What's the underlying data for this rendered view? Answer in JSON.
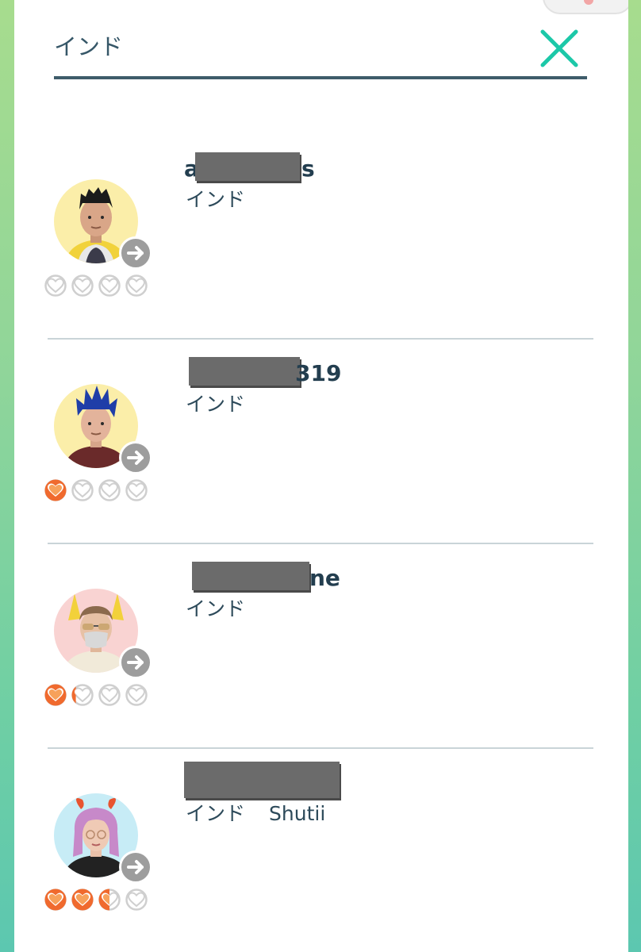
{
  "search": {
    "value": "インド",
    "placeholder": ""
  },
  "clear_icon": "close-icon",
  "colors": {
    "accent": "#1cc8a8",
    "heart_full": "#f06a2e",
    "heart_empty": "#cfcfcf",
    "name_text": "#233e4f"
  },
  "friends": [
    {
      "name_start": "a",
      "name_end": "s",
      "country": "インド",
      "sub": "",
      "friendship_level": 0,
      "avatar_bg": "#fbeea9"
    },
    {
      "name_start": "",
      "name_end": "319",
      "country": "インド",
      "sub": "",
      "friendship_level": 1,
      "avatar_bg": "#fbeea9"
    },
    {
      "name_start": "",
      "name_end": "ne",
      "country": "インド",
      "sub": "",
      "friendship_level": 1.2,
      "avatar_bg": "#f9d3d2"
    },
    {
      "name_start": "",
      "name_end": "",
      "country": "インド",
      "sub": "Shutii",
      "friendship_level": 2.5,
      "avatar_bg": "#c7ecf6"
    }
  ]
}
